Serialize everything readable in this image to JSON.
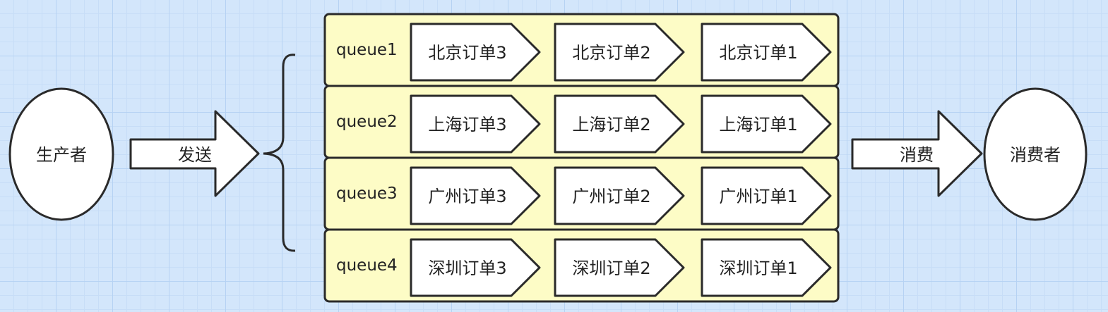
{
  "producer": {
    "label": "生产者"
  },
  "send_arrow": {
    "label": "发送"
  },
  "consume_arrow": {
    "label": "消费"
  },
  "consumer": {
    "label": "消费者"
  },
  "queues": [
    {
      "name": "queue1",
      "items": [
        "北京订单3",
        "北京订单2",
        "北京订单1"
      ]
    },
    {
      "name": "queue2",
      "items": [
        "上海订单3",
        "上海订单2",
        "上海订单1"
      ]
    },
    {
      "name": "queue3",
      "items": [
        "广州订单3",
        "广州订单2",
        "广州订单1"
      ]
    },
    {
      "name": "queue4",
      "items": [
        "深圳订单3",
        "深圳订单2",
        "深圳订单1"
      ]
    }
  ],
  "colors": {
    "queue_fill": "#fdfcc6",
    "stroke": "#2a2a2a",
    "shape_fill": "#ffffff"
  }
}
